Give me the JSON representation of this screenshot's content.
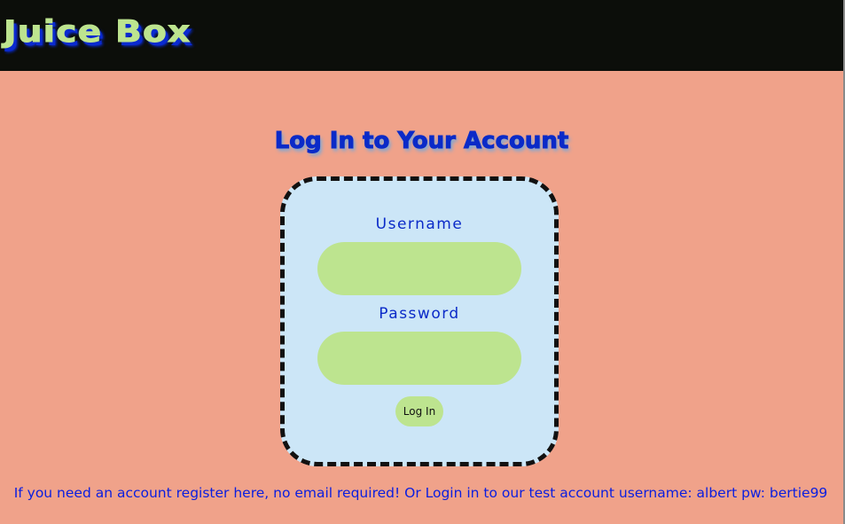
{
  "header": {
    "logo": "Juice Box"
  },
  "login": {
    "title": "Log In to Your Account",
    "username_label": "Username",
    "username_value": "",
    "password_label": "Password",
    "password_value": "",
    "submit_label": "Log In"
  },
  "footer": {
    "register_text": "If you need an account register here, no email required!",
    "test_account_text": "Or Login in to our test account username: albert pw: bertie99"
  },
  "colors": {
    "background": "#f0a28a",
    "header": "#0c0e0a",
    "accent_green": "#bde48f",
    "accent_blue": "#0a2ac8",
    "card": "#cce6f7"
  }
}
